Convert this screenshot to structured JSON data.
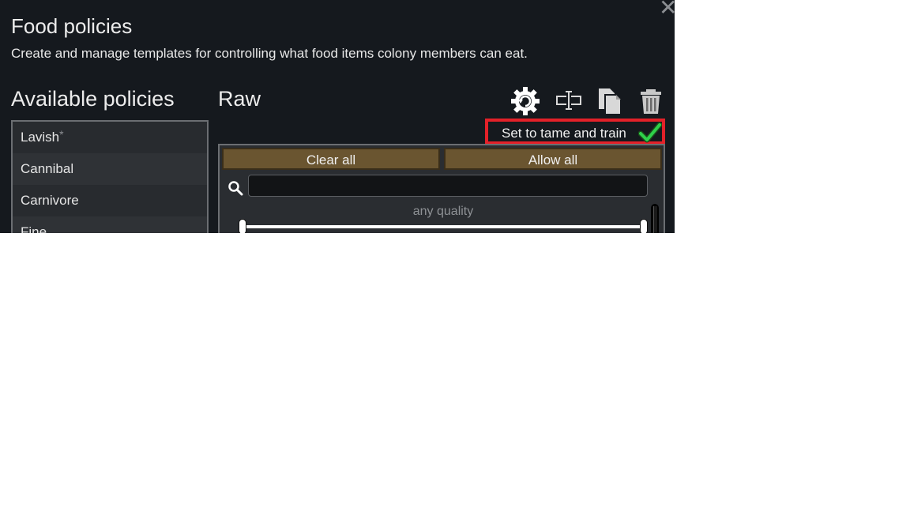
{
  "dialog": {
    "title": "Food policies",
    "subtitle": "Create and manage templates for controlling what food items colony members can eat.",
    "close_icon": "close-icon"
  },
  "policies": {
    "heading": "Available policies",
    "items": [
      {
        "label": "Lavish",
        "modified_mark": "*"
      },
      {
        "label": "Cannibal"
      },
      {
        "label": "Carnivore"
      },
      {
        "label": "Fine"
      }
    ]
  },
  "editor": {
    "policy_name": "Raw",
    "toolbar": {
      "settings_icon": "gear-refresh-icon",
      "rename_icon": "rename-icon",
      "copy_icon": "copy-icon",
      "delete_icon": "trash-icon"
    },
    "tame_button": {
      "label": "Set to tame and train",
      "checked": true,
      "check_color": "#2fd14a",
      "highlight_color": "#e32129"
    },
    "filter": {
      "clear_all": "Clear all",
      "allow_all": "Allow all",
      "search_placeholder": "",
      "quality_label": "any quality"
    }
  }
}
